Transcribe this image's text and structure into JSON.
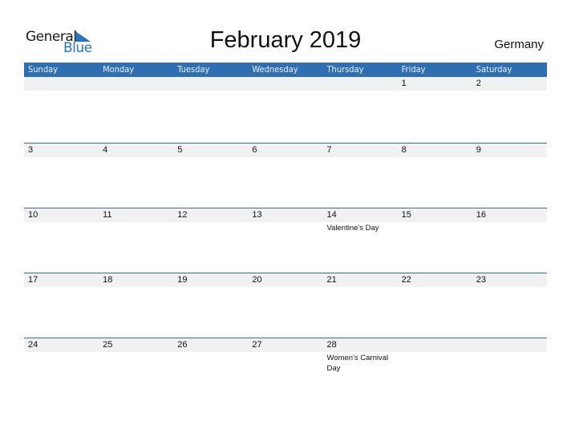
{
  "logo": {
    "text1": "General",
    "text2": "Blue",
    "brand_color": "#2b72b8"
  },
  "title": "February 2019",
  "country": "Germany",
  "header_color": "#2f6fb1",
  "days": [
    "Sunday",
    "Monday",
    "Tuesday",
    "Wednesday",
    "Thursday",
    "Friday",
    "Saturday"
  ],
  "weeks": [
    [
      {
        "day": ""
      },
      {
        "day": ""
      },
      {
        "day": ""
      },
      {
        "day": ""
      },
      {
        "day": ""
      },
      {
        "day": "1"
      },
      {
        "day": "2"
      }
    ],
    [
      {
        "day": "3"
      },
      {
        "day": "4"
      },
      {
        "day": "5"
      },
      {
        "day": "6"
      },
      {
        "day": "7"
      },
      {
        "day": "8"
      },
      {
        "day": "9"
      }
    ],
    [
      {
        "day": "10"
      },
      {
        "day": "11"
      },
      {
        "day": "12"
      },
      {
        "day": "13"
      },
      {
        "day": "14",
        "holiday": "Valentine's Day"
      },
      {
        "day": "15"
      },
      {
        "day": "16"
      }
    ],
    [
      {
        "day": "17"
      },
      {
        "day": "18"
      },
      {
        "day": "19"
      },
      {
        "day": "20"
      },
      {
        "day": "21"
      },
      {
        "day": "22"
      },
      {
        "day": "23"
      }
    ],
    [
      {
        "day": "24"
      },
      {
        "day": "25"
      },
      {
        "day": "26"
      },
      {
        "day": "27"
      },
      {
        "day": "28",
        "holiday": "Women's Carnival Day"
      },
      {
        "day": ""
      },
      {
        "day": ""
      }
    ]
  ]
}
